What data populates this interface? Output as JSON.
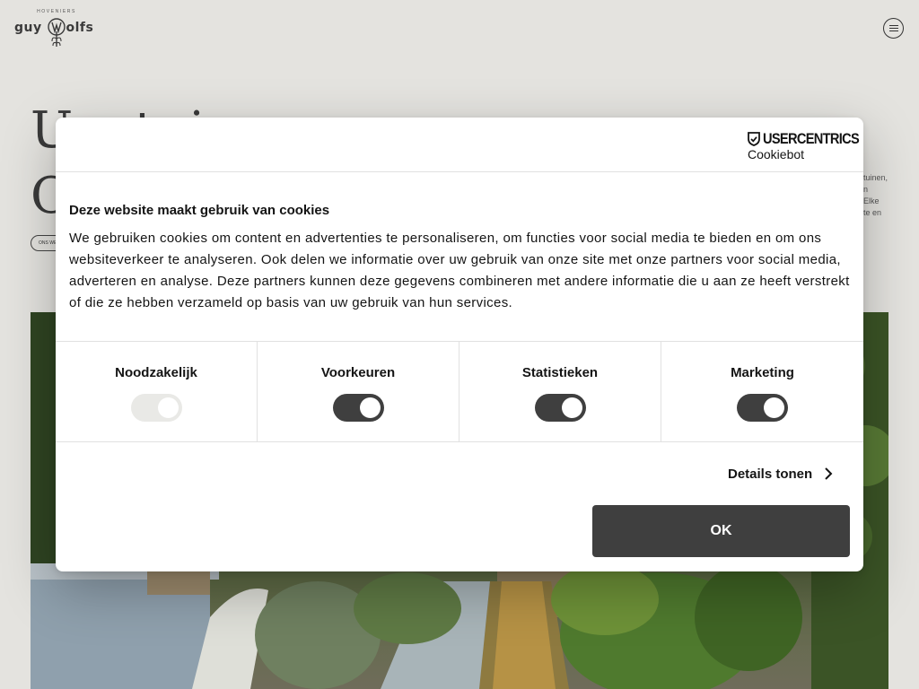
{
  "site": {
    "logo": {
      "subtitle": "HOVENIERS",
      "wordmark": "guy wolfs"
    },
    "hero": {
      "title_line1": "Uw tuin",
      "title_line2": "O",
      "side_text": [
        "tuinen,",
        "n",
        "Elke",
        "te en"
      ],
      "pill_label": "ONS WERK"
    }
  },
  "cookie_banner": {
    "brand": {
      "name": "USERCENTRICS",
      "product": "Cookiebot"
    },
    "title": "Deze website maakt gebruik van cookies",
    "body": "We gebruiken cookies om content en advertenties te personaliseren, om functies voor social media te bieden en om ons websiteverkeer te analyseren. Ook delen we informatie over uw gebruik van onze site met onze partners voor social media, adverteren en analyse. Deze partners kunnen deze gegevens combineren met andere informatie die u aan ze heeft verstrekt of die ze hebben verzameld op basis van uw gebruik van hun services.",
    "categories": [
      {
        "label": "Noodzakelijk",
        "checked": true,
        "disabled": true
      },
      {
        "label": "Voorkeuren",
        "checked": true,
        "disabled": false
      },
      {
        "label": "Statistieken",
        "checked": true,
        "disabled": false
      },
      {
        "label": "Marketing",
        "checked": true,
        "disabled": false
      }
    ],
    "details_label": "Details tonen",
    "ok_label": "OK"
  },
  "colors": {
    "page_background": "#e4e3df",
    "dialog_background": "#ffffff",
    "toggle_on": "#3f3f3f",
    "toggle_disabled": "#e9e9e6",
    "ok_button": "#3f3f3f"
  }
}
